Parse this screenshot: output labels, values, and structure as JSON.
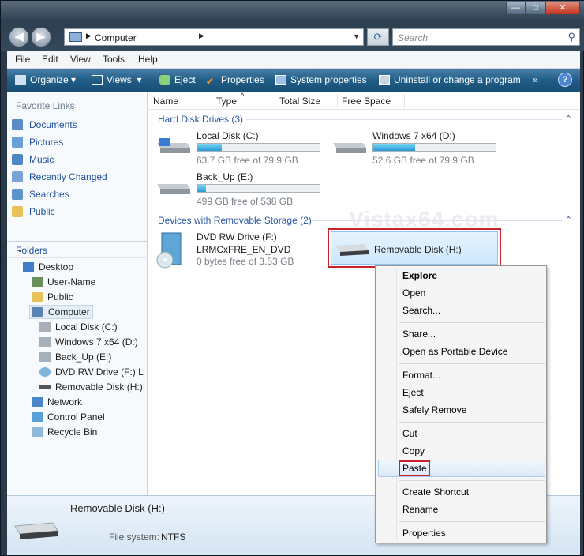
{
  "titlebar": {
    "minimize": "—",
    "maximize": "□",
    "close": "✕"
  },
  "nav": {
    "back": "◀",
    "forward": "▶",
    "address": "Computer",
    "search_placeholder": "Search"
  },
  "menu": [
    "File",
    "Edit",
    "View",
    "Tools",
    "Help"
  ],
  "toolbar": {
    "organize": "Organize",
    "views": "Views",
    "eject": "Eject",
    "properties": "Properties",
    "system_properties": "System properties",
    "uninstall": "Uninstall or change a program",
    "more": "»",
    "help": "?"
  },
  "favorites": {
    "title": "Favorite Links",
    "items": [
      "Documents",
      "Pictures",
      "Music",
      "Recently Changed",
      "Searches",
      "Public"
    ]
  },
  "folders": {
    "title": "Folders",
    "tree": [
      "Desktop",
      "User-Name",
      "Public",
      "Computer",
      "Local Disk (C:)",
      "Windows 7 x64 (D:)",
      "Back_Up (E:)",
      "DVD RW Drive (F:) LRM",
      "Removable Disk (H:)",
      "Network",
      "Control Panel",
      "Recycle Bin"
    ]
  },
  "columns": [
    "Name",
    "Type",
    "Total Size",
    "Free Space"
  ],
  "groups": {
    "hdd": "Hard Disk Drives (3)",
    "removable": "Devices with Removable Storage (2)"
  },
  "drives": [
    {
      "name": "Local Disk (C:)",
      "free": "63.7 GB free of 79.9 GB",
      "used_fraction": 0.2
    },
    {
      "name": "Windows 7 x64 (D:)",
      "free": "52.6 GB free of 79.9 GB",
      "used_fraction": 0.34
    },
    {
      "name": "Back_Up (E:)",
      "free": "499 GB free of 538 GB",
      "used_fraction": 0.07
    }
  ],
  "dvd": {
    "name": "DVD RW Drive (F:)",
    "label": "LRMCxFRE_EN_DVD",
    "free": "0 bytes free of 3.53 GB"
  },
  "removable": {
    "name": "Removable Disk (H:)"
  },
  "watermark": "Vistax64.com",
  "context_menu": {
    "explore": "Explore",
    "open": "Open",
    "search": "Search...",
    "share": "Share...",
    "open_portable": "Open as Portable Device",
    "format": "Format...",
    "eject": "Eject",
    "safely_remove": "Safely Remove",
    "cut": "Cut",
    "copy": "Copy",
    "paste": "Paste",
    "create_shortcut": "Create Shortcut",
    "rename": "Rename",
    "properties": "Properties"
  },
  "details": {
    "name": "Removable Disk (H:)",
    "fs_label": "File system:",
    "fs_value": "NTFS"
  }
}
